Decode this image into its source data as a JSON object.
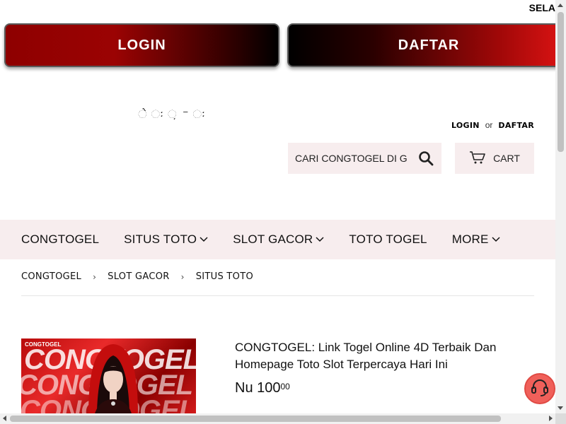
{
  "marquee": {
    "text": "SELA"
  },
  "cta": {
    "login_label": "LOGIN",
    "daftar_label": "DAFTAR"
  },
  "logo": {
    "glyphs": "ે ઃ       ઼ ⁻ ઃ"
  },
  "account": {
    "login": "LOGIN",
    "or": "or",
    "daftar": "DAFTAR"
  },
  "search": {
    "placeholder": "CARI CONGTOGEL DI G",
    "icon": "search-icon"
  },
  "cart": {
    "label": "CART",
    "icon": "cart-icon"
  },
  "nav": {
    "items": [
      {
        "label": "CONGTOGEL",
        "dropdown": false
      },
      {
        "label": "SITUS TOTO",
        "dropdown": true
      },
      {
        "label": "SLOT GACOR",
        "dropdown": true
      },
      {
        "label": "TOTO TOGEL",
        "dropdown": false
      },
      {
        "label": "MORE",
        "dropdown": true
      }
    ]
  },
  "breadcrumb": {
    "items": [
      "CONGTOGEL",
      "SLOT GACOR",
      "SITUS TOTO"
    ],
    "separator": "›"
  },
  "product": {
    "title": "CONGTOGEL: Link Togel Online 4D Terbaik Dan Homepage Toto Slot Terpercaya Hari Ini",
    "price_main": "Nu 100",
    "price_cents": "00",
    "image_brand": "CONGTOGEL",
    "image_text": "CONGTOGEL"
  },
  "colors": {
    "accent_red": "#a00808",
    "nav_bg": "#f7edee",
    "support_bg": "#f0605a"
  }
}
